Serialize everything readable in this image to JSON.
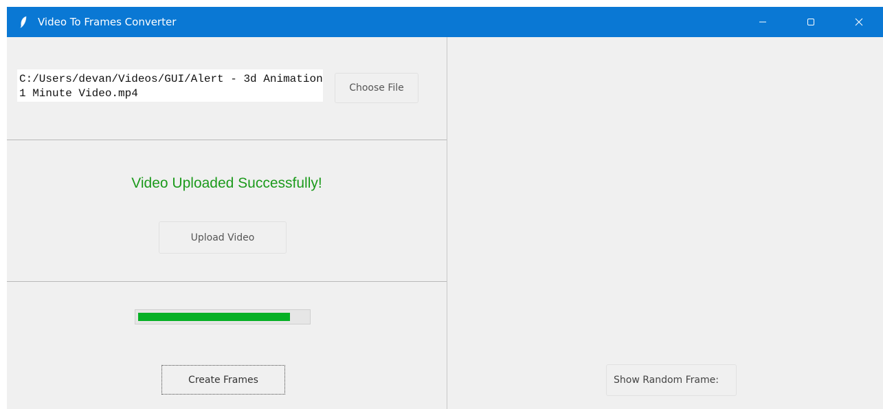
{
  "window": {
    "title": "Video To Frames Converter",
    "icon": "feather-icon",
    "controls": [
      "minimize-icon",
      "maximize-icon",
      "close-icon"
    ],
    "titlebar_color": "#0a78d4"
  },
  "file_section": {
    "path_value": "C:/Users/devan/Videos/GUI/Alert - 3d Animation 1 Minute Video.mp4",
    "choose_label": "Choose File"
  },
  "upload_section": {
    "status": "Video Uploaded Successfully!",
    "status_color": "#1c9a1c",
    "upload_label": "Upload Video"
  },
  "frames_section": {
    "progress": 0.9,
    "progress_color": "#06b025",
    "create_label": "Create Frames"
  },
  "right_panel": {
    "random_label": "Show Random Frame:"
  }
}
